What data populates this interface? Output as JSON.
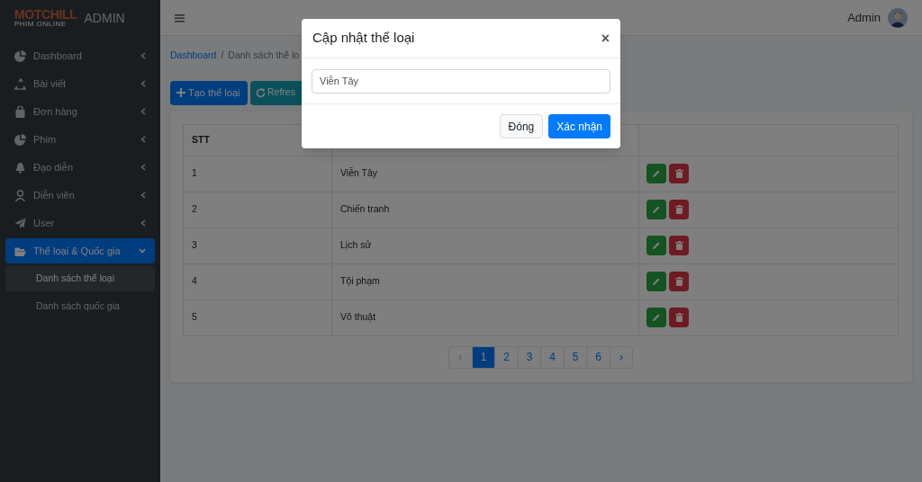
{
  "brand": {
    "logo": "MOTCHILL",
    "tagline": "PHIM ONLINE",
    "label": "ADMIN"
  },
  "sidebar": {
    "items": [
      {
        "label": "Dashboard",
        "kind": "pie",
        "expanded": false,
        "selected": false
      },
      {
        "label": "Bài viết",
        "kind": "recycle",
        "expanded": false,
        "selected": false
      },
      {
        "label": "Đơn hàng",
        "kind": "bag",
        "expanded": false,
        "selected": false
      },
      {
        "label": "Phim",
        "kind": "pie",
        "expanded": false,
        "selected": false
      },
      {
        "label": "Đạo diễn",
        "kind": "bell",
        "expanded": false,
        "selected": false
      },
      {
        "label": "Diễn viên",
        "kind": "person",
        "expanded": false,
        "selected": false
      },
      {
        "label": "User",
        "kind": "plane",
        "expanded": false,
        "selected": false
      },
      {
        "label": "Thể loại & Quốc gia",
        "kind": "folder",
        "expanded": true,
        "selected": true,
        "children": [
          {
            "label": "Danh sách thể loại",
            "selected": true
          },
          {
            "label": "Danh sách quốc gia",
            "selected": false
          }
        ]
      }
    ]
  },
  "header": {
    "user": "Admin"
  },
  "breadcrumb": {
    "items": [
      "Dashboard",
      "Danh sách thể lo"
    ],
    "separator": "/"
  },
  "toolbar": [
    {
      "label": "Tạo thể loại",
      "kind": "create"
    },
    {
      "label": "Refres",
      "kind": "refresh"
    }
  ],
  "table": {
    "columns": [
      "STT"
    ],
    "rows": [
      [
        "1",
        "Viễn Tây"
      ],
      [
        "2",
        "Chiến tranh"
      ],
      [
        "3",
        "Lịch sử"
      ],
      [
        "4",
        "Tội phạm"
      ],
      [
        "5",
        "Võ thuật"
      ]
    ]
  },
  "pagination": [
    {
      "label": "‹",
      "selected": false,
      "disabled": true
    },
    {
      "label": "1",
      "selected": true,
      "disabled": false
    },
    {
      "label": "2",
      "selected": false,
      "disabled": false
    },
    {
      "label": "3",
      "selected": false,
      "disabled": false
    },
    {
      "label": "4",
      "selected": false,
      "disabled": false
    },
    {
      "label": "5",
      "selected": false,
      "disabled": false
    },
    {
      "label": "6",
      "selected": false,
      "disabled": false
    },
    {
      "label": "›",
      "selected": false,
      "disabled": false
    }
  ],
  "modal": {
    "title": "Cập nhật thể loại",
    "close": "×",
    "value": "Viễn Tây",
    "buttons": [
      {
        "label": "Đóng",
        "kind": "secondary"
      },
      {
        "label": "Xác nhận",
        "kind": "primary"
      }
    ]
  }
}
